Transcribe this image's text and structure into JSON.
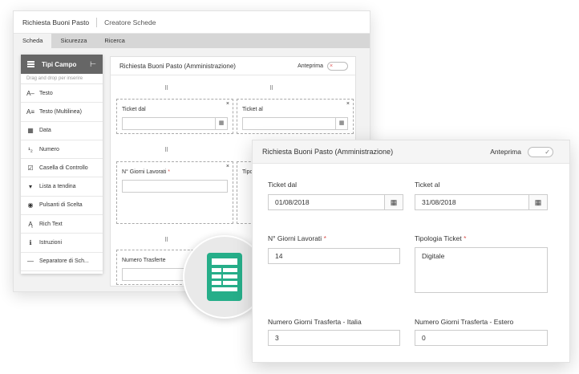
{
  "back_window": {
    "title": "Richiesta Buoni Pasto",
    "subtitle": "Creatore Schede",
    "tabs": [
      "Scheda",
      "Sicurezza",
      "Ricerca"
    ],
    "palette": {
      "header": "Tipi Campo",
      "collapse_icon": "⊢",
      "hint": "Drag and drop per inserire",
      "items": [
        {
          "icon": "A–",
          "label": "Testo"
        },
        {
          "icon": "A≡",
          "label": "Testo (Multilinea)"
        },
        {
          "icon": "▦",
          "label": "Data"
        },
        {
          "icon": "¹₂",
          "label": "Numero"
        },
        {
          "icon": "☑",
          "label": "Casella di Controllo"
        },
        {
          "icon": "▾",
          "label": "Lista a tendina"
        },
        {
          "icon": "◉",
          "label": "Pulsanti di Scelta"
        },
        {
          "icon": "Ą",
          "label": "Rich Text"
        },
        {
          "icon": "ℹ",
          "label": "Istruzioni"
        },
        {
          "icon": "—",
          "label": "Separatore di Sch..."
        }
      ]
    },
    "canvas": {
      "title": "Richiesta Buoni Pasto (Amministrazione)",
      "preview_label": "Anteprima",
      "toggle_icon": "×",
      "drag_handle": "⠿",
      "close_icon": "×",
      "calendar_icon": "▦",
      "fields": {
        "ticket_dal": "Ticket dal",
        "ticket_al": "Ticket al",
        "giorni_lavorati": "N° Giorni Lavorati",
        "tipologia_partial": "Tipo",
        "numero_trasferte": "Numero Trasferte",
        "required_mark": "*"
      }
    }
  },
  "front_window": {
    "title": "Richiesta Buoni Pasto (Amministrazione)",
    "preview_label": "Anteprima",
    "toggle_icon": "✓",
    "calendar_icon": "▦",
    "required_mark": "*",
    "fields": {
      "ticket_dal": {
        "label": "Ticket dal",
        "value": "01/08/2018"
      },
      "ticket_al": {
        "label": "Ticket al",
        "value": "31/08/2018"
      },
      "giorni_lavorati": {
        "label": "N° Giorni Lavorati",
        "value": "14"
      },
      "tipologia_ticket": {
        "label": "Tipologia Ticket",
        "value": "Digitale"
      },
      "trasferta_italia": {
        "label": "Numero Giorni Trasferta - Italia",
        "value": "3"
      },
      "trasferta_estero": {
        "label": "Numero Giorni Trasferta - Estero",
        "value": "0"
      }
    }
  },
  "colors": {
    "accent_green": "#26ae89",
    "required_red": "#d9534f",
    "palette_header": "#666666"
  }
}
